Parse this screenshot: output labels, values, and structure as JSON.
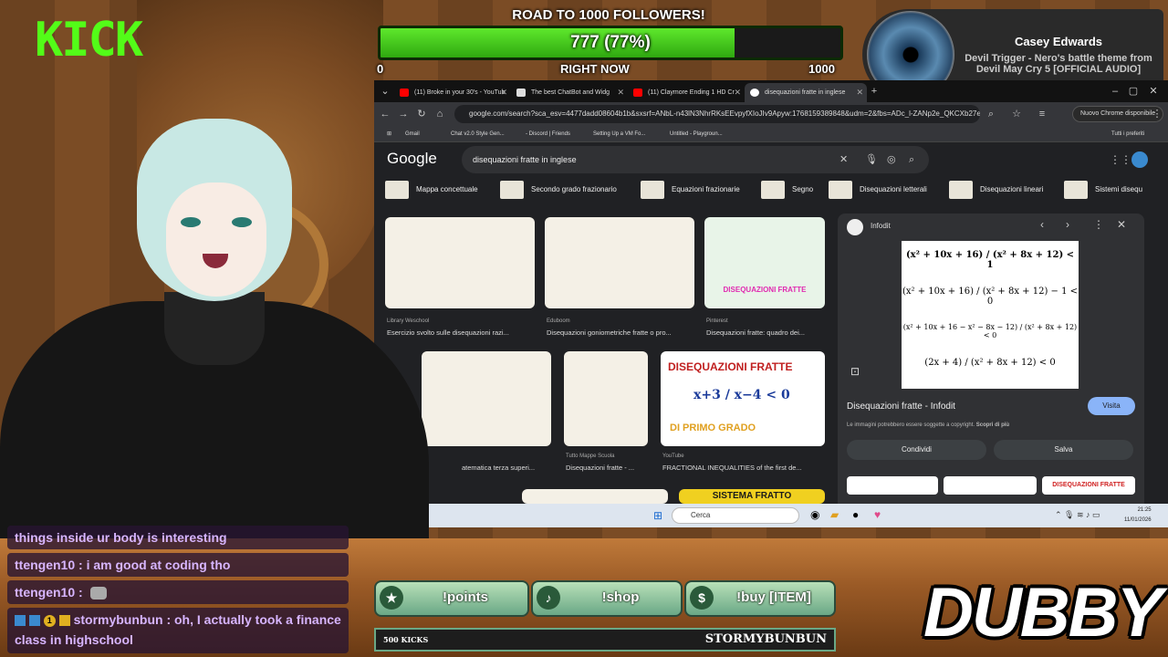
{
  "brand": {
    "kick_logo": "KICK",
    "streamer_logo": "DUBBY"
  },
  "goal": {
    "title": "ROAD TO 1000 FOLLOWERS!",
    "progress_text": "777 (77%)",
    "progress": 0.77,
    "min_label": "0",
    "mid_label": "RIGHT NOW",
    "max_label": "1000",
    "fill_color": "#53fc18"
  },
  "now_playing": {
    "artist": "Casey Edwards",
    "track": "Devil Trigger - Nero's battle theme from Devil May Cry 5 [OFFICIAL AUDIO]"
  },
  "browser": {
    "tabs": [
      {
        "label": "(11) Broke in your 30's - YouTub",
        "favicon": "youtube-icon"
      },
      {
        "label": "The best ChatBot and Widg",
        "favicon": "bot-icon"
      },
      {
        "label": "(11) Claymore Ending 1 HD Cr",
        "favicon": "youtube-icon"
      },
      {
        "label": "disequazioni fratte in inglese",
        "favicon": "google-icon"
      }
    ],
    "url": "google.com/search?sca_esv=4477dadd08604b1b&sxsrf=ANbL-n43lN3NhrRKsEEvpyfXIoJIv9Apyw:1768159389848&udm=2&fbs=ADc_l-ZANp2e_QKCXb27eIGbV...",
    "update_label": "Nuovo Chrome disponibile",
    "bookmarks": [
      "Gmail",
      "Chat v2.0 Style Gen...",
      "- Discord | Friends",
      "Setting Up a VM Fo...",
      "Untitled - Playgroun..."
    ],
    "all_bookmarks": "Tutti i preferiti",
    "google_logo": "Google",
    "search_query": "disequazioni fratte in inglese",
    "chips": [
      "Mappa concettuale",
      "Secondo grado frazionario",
      "Equazioni frazionarie",
      "Segno",
      "Disequazioni letterali",
      "Disequazioni lineari",
      "Sistemi disequ"
    ],
    "results": [
      {
        "source": "Library Weschool",
        "title": "Esercizio svolto sulle disequazioni razi..."
      },
      {
        "source": "Eduboom",
        "title": "Disequazioni goniometriche fratte o pro..."
      },
      {
        "source": "Pinterest",
        "title": "Disequazioni fratte: quadro dei..."
      },
      {
        "source": "",
        "title": "atematica terza superi..."
      },
      {
        "source": "Tutto Mappe Scuola",
        "title": "Disequazioni fratte - ..."
      },
      {
        "source": "YouTube",
        "title": "FRACTIONAL INEQUALITIES of the first de..."
      }
    ],
    "result_image_texts": {
      "pinterest": "DISEQUAZIONI FRATTE",
      "youtube_title": "DISEQUAZIONI FRATTE",
      "youtube_sub": "DI PRIMO GRADO",
      "bottom": "SISTEMA FRATTO"
    },
    "panel": {
      "source": "Infodit",
      "title": "Disequazioni fratte - Infodit",
      "visit_label": "Visita",
      "note": "Le immagini potrebbero essere soggette a copyright.",
      "note_link": "Scopri di più",
      "share_label": "Condividi",
      "save_label": "Salva",
      "thumb_label": "DISEQUAZIONI FRATTE"
    },
    "taskbar": {
      "search_placeholder": "Cerca",
      "time": "21:25",
      "date": "11/01/2026"
    }
  },
  "chat": [
    {
      "text": "things inside ur body is interesting"
    },
    {
      "text": "ttengen10 : i am good at coding tho"
    },
    {
      "text": "ttengen10 :"
    },
    {
      "text": "stormybunbun : oh, I actually took a finance class in highschool",
      "badge": "1"
    }
  ],
  "commands": [
    {
      "label": "!points",
      "icon": "star-icon"
    },
    {
      "label": "!shop",
      "icon": "music-note-icon"
    },
    {
      "label": "!buy [ITEM]",
      "icon": "dollar-icon"
    }
  ],
  "kicks": {
    "count": "500 KICKS",
    "user": "STORMYBUNBUN"
  }
}
